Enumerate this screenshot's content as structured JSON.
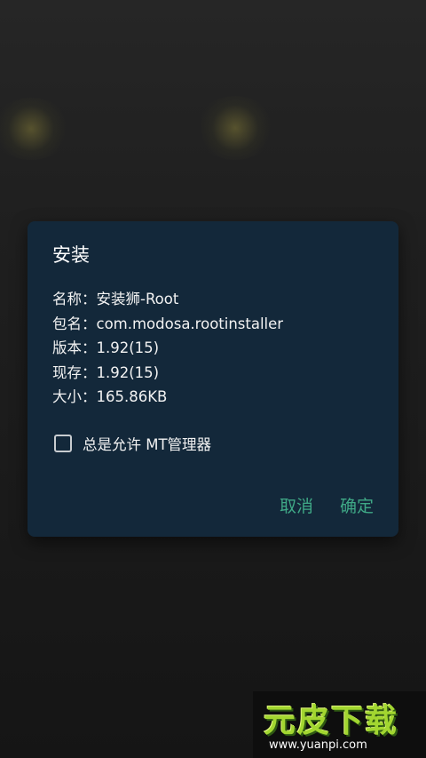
{
  "dialog": {
    "title": "安装",
    "info": [
      {
        "label": "名称：",
        "value": "安装狮-Root"
      },
      {
        "label": "包名：",
        "value": "com.modosa.rootinstaller"
      },
      {
        "label": "版本：",
        "value": "1.92(15)"
      },
      {
        "label": "现存：",
        "value": "1.92(15)"
      },
      {
        "label": "大小：",
        "value": "165.86KB"
      }
    ],
    "checkbox_label": "总是允许 MT管理器",
    "checkbox_checked": false,
    "cancel_label": "取消",
    "confirm_label": "确定"
  },
  "watermark": {
    "logo_text": "元皮下载",
    "url": "www.yuanpi.com"
  },
  "colors": {
    "dialog_bg": "#13283a",
    "accent": "#3fa886"
  }
}
